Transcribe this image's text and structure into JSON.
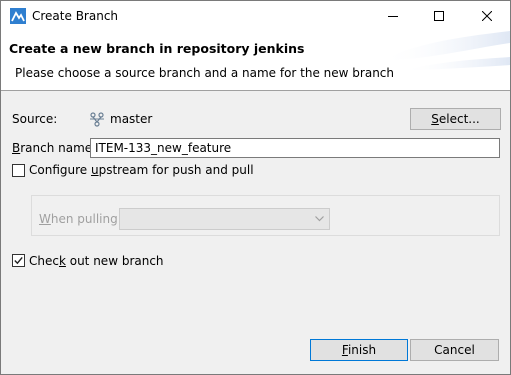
{
  "window": {
    "title": "Create Branch"
  },
  "banner": {
    "title": "Create a new branch in repository jenkins",
    "description": "Please choose a source branch and a name for the new branch"
  },
  "source": {
    "label_mnemonic": "",
    "label": "Source:",
    "value": "master",
    "select_button_mnemonic": "S",
    "select_button_rest": "elect..."
  },
  "branch_name": {
    "label_mnemonic": "B",
    "label_rest": "ranch name:",
    "value": "ITEM-133_new_feature"
  },
  "upstream": {
    "label_pre": "Configure ",
    "label_mnemonic": "u",
    "label_post": "pstream for push and pull",
    "checked": false
  },
  "when_pulling": {
    "label_mnemonic": "W",
    "label_rest": "hen pulling:",
    "selected": ""
  },
  "checkout": {
    "label_pre": "Chec",
    "label_mnemonic": "k",
    "label_post": " out new branch",
    "checked": true
  },
  "buttons": {
    "finish_mnemonic": "F",
    "finish_rest": "inish",
    "cancel": "Cancel"
  },
  "icons": {
    "app": "eclipse-egit-icon",
    "branch": "branch-icon",
    "minimize": "minimize-icon",
    "maximize": "maximize-icon",
    "close": "close-icon",
    "combo_arrow": "chevron-down-icon",
    "check": "check-icon"
  },
  "colors": {
    "dialog_bg": "#f0f0f0",
    "banner_bg": "#ffffff",
    "default_button_border": "#0078d7",
    "app_icon_blue": "#2f7fd0"
  }
}
